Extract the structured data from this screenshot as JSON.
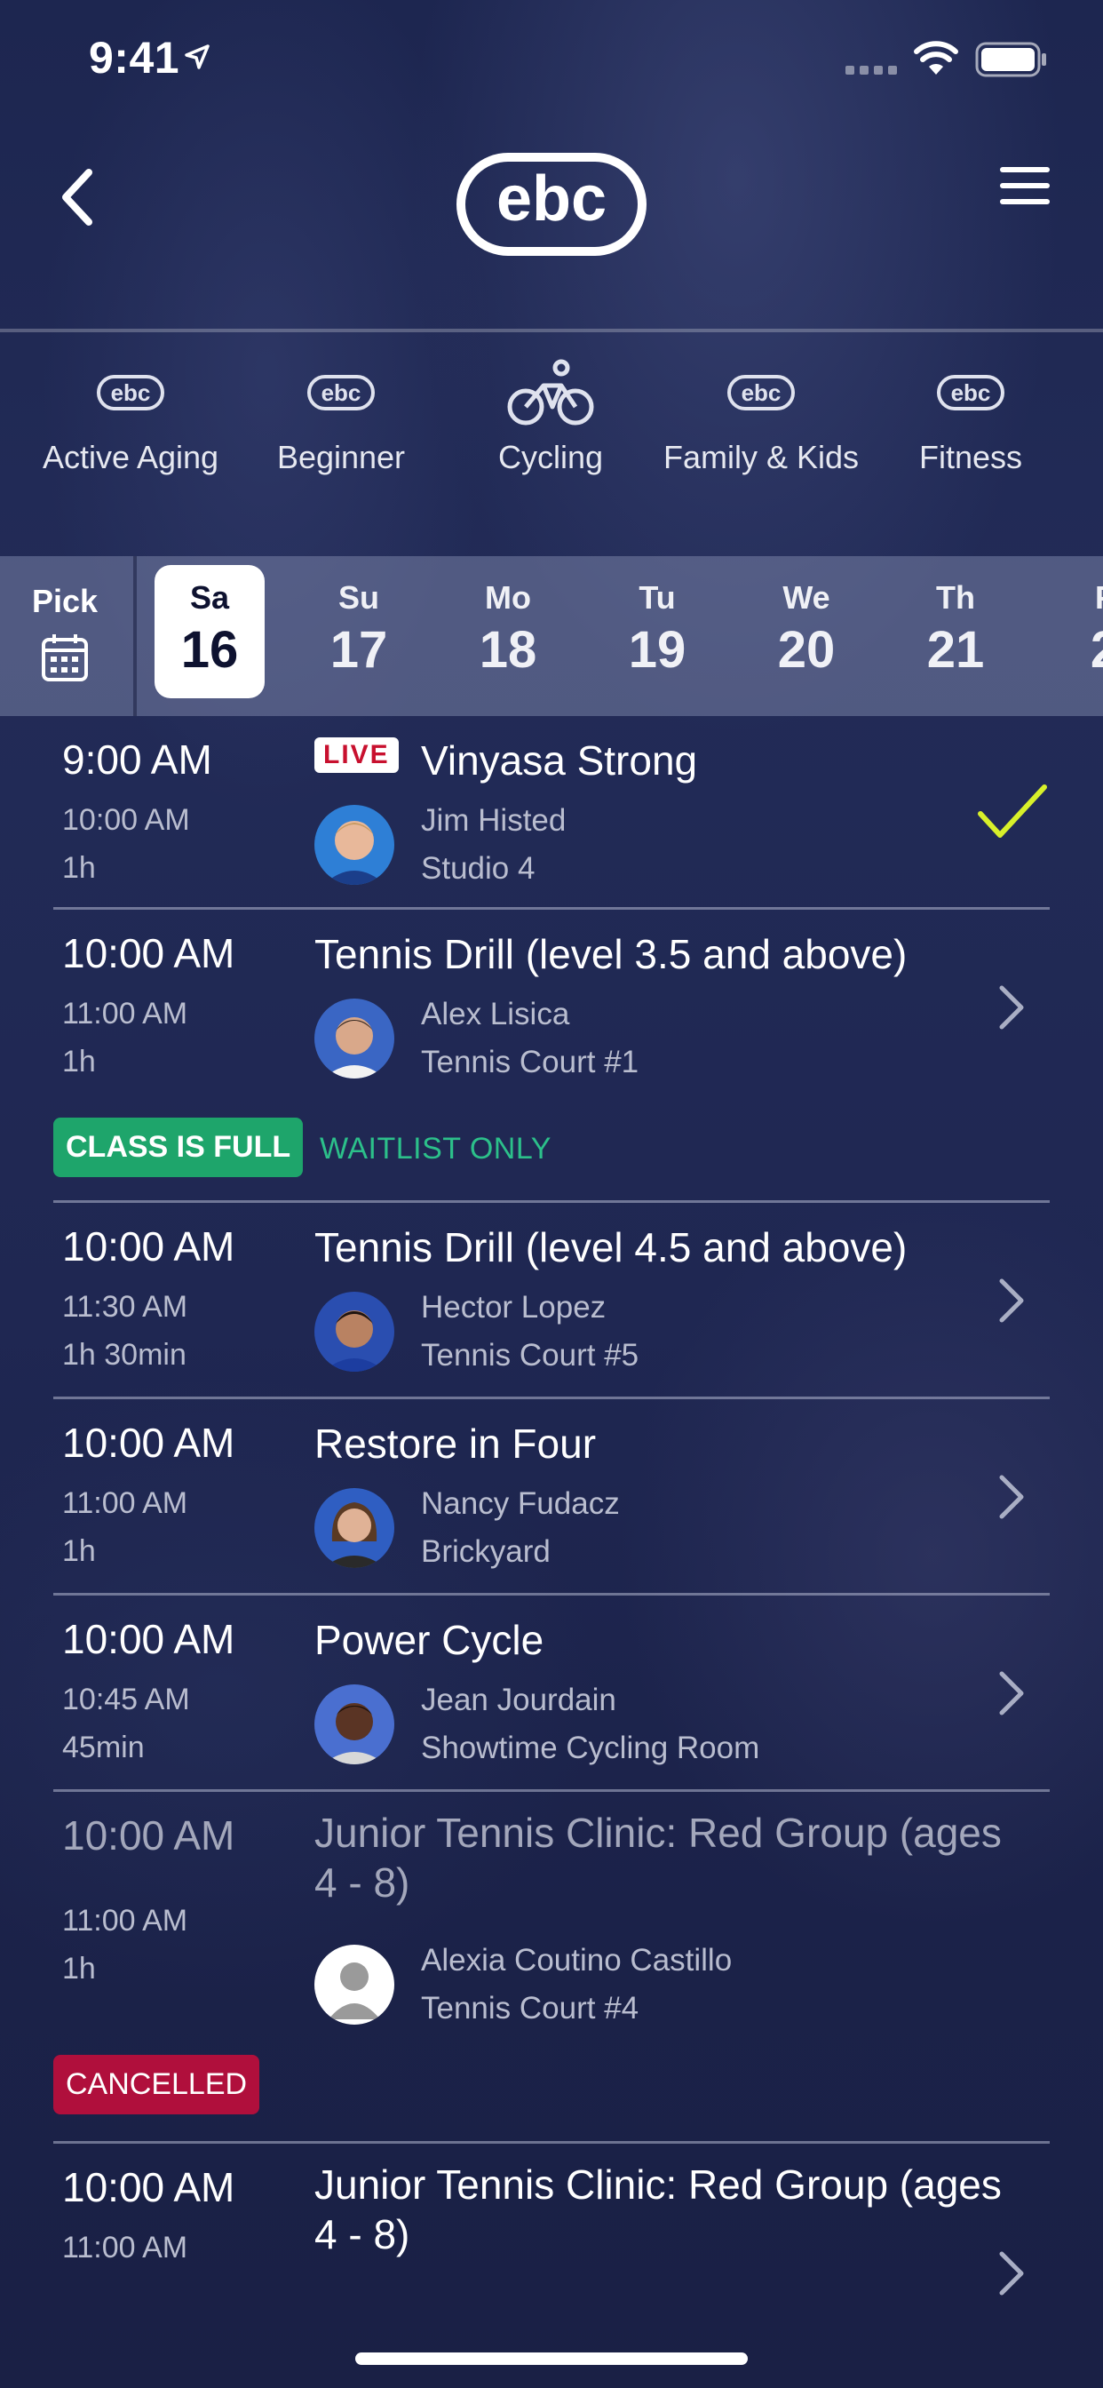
{
  "status_bar": {
    "time": "9:41"
  },
  "nav": {
    "logo_text": "ebc"
  },
  "categories": [
    {
      "label": "Active Aging",
      "icon": "ebc-logo-icon"
    },
    {
      "label": "Beginner",
      "icon": "ebc-logo-icon"
    },
    {
      "label": "Cycling",
      "icon": "bicycle-icon"
    },
    {
      "label": "Family & Kids",
      "icon": "ebc-logo-icon"
    },
    {
      "label": "Fitness",
      "icon": "ebc-logo-icon"
    }
  ],
  "date_strip": {
    "pick_label": "Pick",
    "days": [
      {
        "dow": "Sa",
        "num": "16",
        "selected": true
      },
      {
        "dow": "Su",
        "num": "17"
      },
      {
        "dow": "Mo",
        "num": "18"
      },
      {
        "dow": "Tu",
        "num": "19"
      },
      {
        "dow": "We",
        "num": "20"
      },
      {
        "dow": "Th",
        "num": "21"
      },
      {
        "dow": "F",
        "num": "2"
      }
    ]
  },
  "classes": [
    {
      "start": "9:00 AM",
      "end": "10:00 AM",
      "duration": "1h",
      "badge": "LIVE",
      "title": "Vinyasa Strong",
      "instructor": "Jim Histed",
      "room": "Studio 4",
      "status_icon": "checkmark-icon"
    },
    {
      "start": "10:00 AM",
      "end": "11:00 AM",
      "duration": "1h",
      "title": "Tennis Drill (level 3.5 and above)",
      "instructor": "Alex Lisica",
      "room": "Tennis Court #1",
      "status_label": "CLASS IS FULL",
      "status_note": "WAITLIST ONLY"
    },
    {
      "start": "10:00 AM",
      "end": "11:30 AM",
      "duration": "1h 30min",
      "title": "Tennis Drill (level 4.5 and above)",
      "instructor": "Hector Lopez",
      "room": "Tennis Court #5"
    },
    {
      "start": "10:00 AM",
      "end": "11:00 AM",
      "duration": "1h",
      "title": "Restore in Four",
      "instructor": "Nancy Fudacz",
      "room": "Brickyard"
    },
    {
      "start": "10:00 AM",
      "end": "10:45 AM",
      "duration": "45min",
      "title": "Power Cycle",
      "instructor": "Jean Jourdain",
      "room": "Showtime Cycling Room"
    },
    {
      "start": "10:00 AM",
      "end": "11:00 AM",
      "duration": "1h",
      "title": "Junior Tennis Clinic: Red Group (ages 4 - 8)",
      "instructor": "Alexia Coutino Castillo",
      "room": "Tennis Court #4",
      "status_label": "CANCELLED"
    },
    {
      "start": "10:00 AM",
      "end": "11:00 AM",
      "title": "Junior Tennis Clinic: Red Group (ages 4 - 8)"
    }
  ],
  "colors": {
    "background": "#1d2650",
    "live_red": "#c8102e",
    "full_green": "#1ea56b",
    "waitlist_green": "#2cc08a",
    "cancelled_red": "#b00f3c",
    "check_yellow": "#d8f02a"
  }
}
